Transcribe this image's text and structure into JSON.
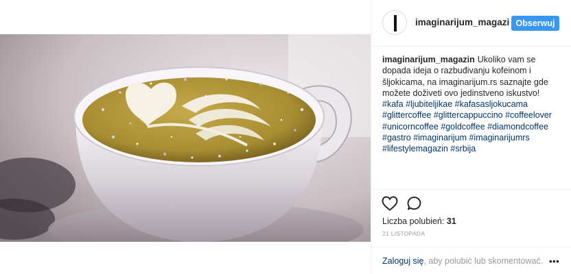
{
  "post": {
    "username": "imaginarijum_magazi",
    "follow_label": "Obserwuj",
    "caption_user": "imaginarijum_magazin",
    "caption_text": "Ukoliko vam se dopada ideja o razbuđivanju kofeinom i šljokicama, na imaginarijum.rs saznajte gde možete doživeti ovo jedinstveno iskustvo!",
    "hashtags": [
      "#kafa",
      "#ljubiteljikae",
      "#kafasasljokucama",
      "#glittercoffee",
      "#glittercappuccino",
      "#coffeelover",
      "#unicorncoffee",
      "#goldcoffee",
      "#diamondcoffee",
      "#gastro",
      "#imaginarijum",
      "#imaginarijumrs",
      "#lifestylemagazin",
      "#srbija"
    ],
    "likes_label": "Liczba polubień:",
    "likes_count": "31",
    "date": "21 LISTOPADA",
    "login_link": "Zaloguj się",
    "login_rest": ", aby polubić lub skomentować.",
    "more_label": "•••"
  },
  "icons": {
    "like": "heart-icon",
    "comment": "comment-icon",
    "more": "more-options-icon"
  },
  "colors": {
    "follow_button": "#3897f0",
    "hashtag": "#003569",
    "muted_text": "#999999",
    "divider": "#efefef"
  }
}
